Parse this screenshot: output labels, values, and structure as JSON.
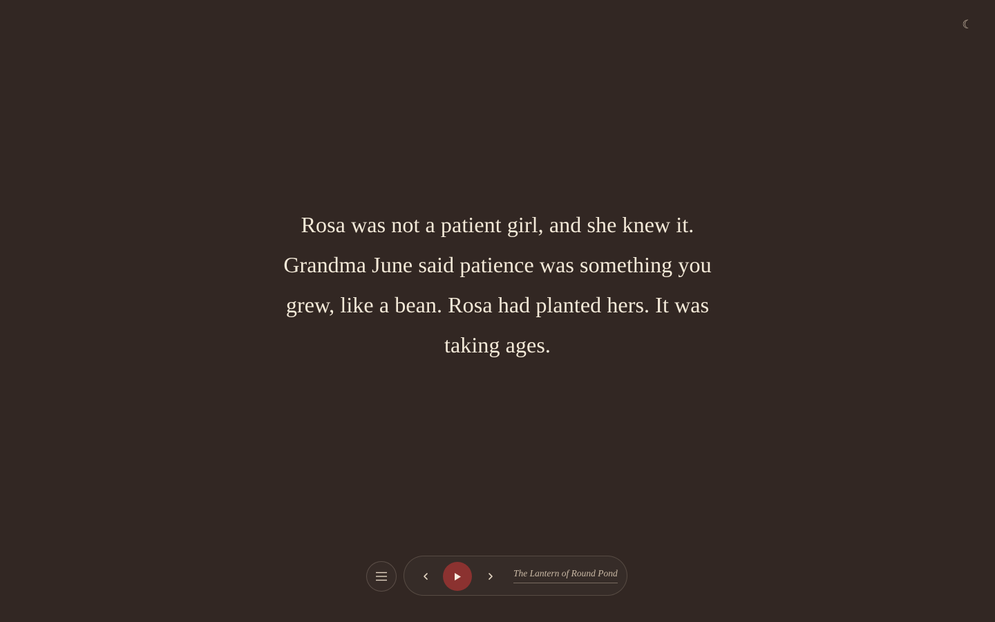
{
  "header": {
    "theme_toggle_glyph": "☾"
  },
  "story": {
    "text": "Rosa was not a patient girl, and she knew it. Grandma June said patience was something you grew, like a bean. Rosa had planted hers. It was taking ages."
  },
  "controls": {
    "menu_icon": "menu-icon",
    "prev_icon": "chevron-left-icon",
    "play_icon": "play-icon",
    "next_icon": "chevron-right-icon",
    "book_title": "The Lantern of Round Pond"
  },
  "colors": {
    "background": "#322723",
    "text": "#f3e9d8",
    "accent": "#8b3230",
    "muted": "#c9b8a4"
  }
}
